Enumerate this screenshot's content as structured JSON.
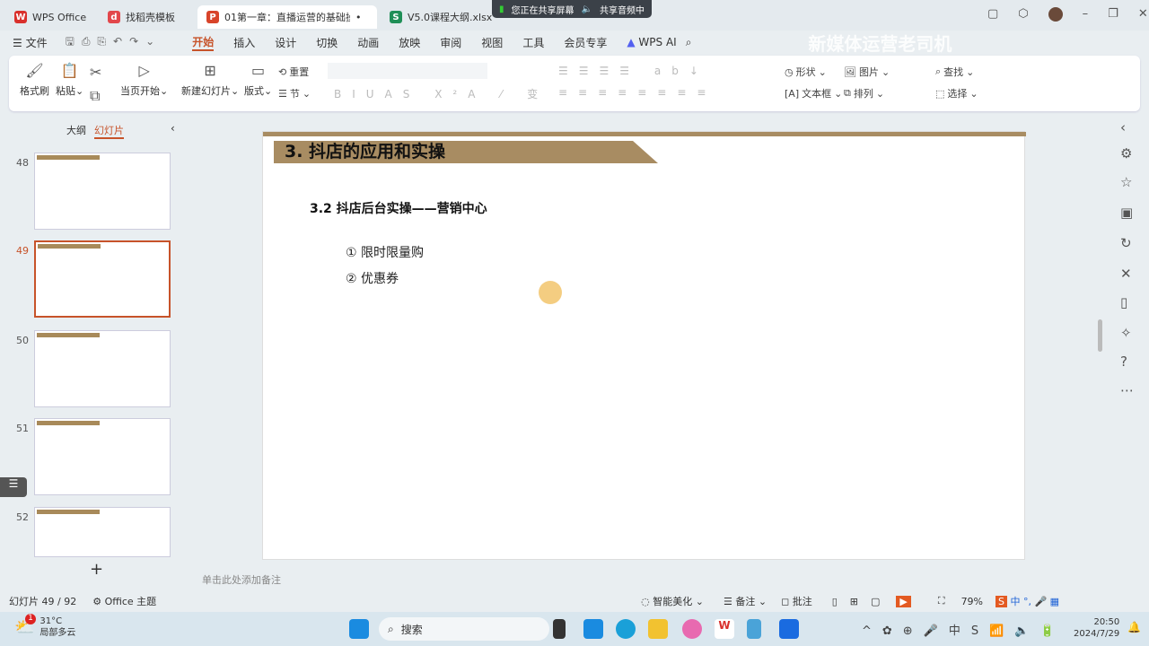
{
  "tabs": [
    {
      "label": "WPS Office",
      "icon": "wps-logo",
      "color": "#d9302c"
    },
    {
      "label": "找稻壳模板",
      "icon": "docer-icon",
      "color": "#e2474b"
    },
    {
      "label": "01第一章：直播运营的基础操",
      "icon": "presentation-icon",
      "color": "#d8442a"
    },
    {
      "label": "V5.0课程大纲.xlsx",
      "icon": "spreadsheet-icon",
      "color": "#1f8f57"
    }
  ],
  "share": {
    "screen": "您正在共享屏幕",
    "audio": "共享音频中"
  },
  "menu": {
    "file": "文件",
    "items": [
      "开始",
      "插入",
      "设计",
      "切换",
      "动画",
      "放映",
      "审阅",
      "视图",
      "工具",
      "会员专享"
    ],
    "ai": "WPS AI"
  },
  "watermark": "新媒体运营老司机",
  "ribbon": {
    "format_painter": "格式刷",
    "paste": "粘贴",
    "from_current": "当页开始",
    "new_slide": "新建幻灯片",
    "layout": "版式",
    "reset": "重置",
    "section": "节",
    "shape": "形状",
    "picture": "图片",
    "textbox": "文本框",
    "arrange": "排列",
    "find": "查找",
    "select": "选择"
  },
  "panel": {
    "outline": "大纲",
    "slides": "幻灯片",
    "thumbs": [
      {
        "num": "48"
      },
      {
        "num": "49",
        "selected": true
      },
      {
        "num": "50"
      },
      {
        "num": "51"
      },
      {
        "num": "52"
      }
    ],
    "add": "+"
  },
  "slide": {
    "title": "3. 抖店的应用和实操",
    "subtitle": "3.2  抖店后台实操——营销中心",
    "items": [
      "①  限时限量购",
      "②  优惠券"
    ]
  },
  "notes_placeholder": "单击此处添加备注",
  "status": {
    "slide_count": "幻灯片 49 / 92",
    "theme": "Office 主题",
    "beautify": "智能美化",
    "notes": "备注",
    "comment": "批注",
    "zoom": "79%"
  },
  "taskbar": {
    "temp": "31°C",
    "weather": "局部多云",
    "badge": "1",
    "search": "搜索",
    "time": "20:50",
    "date": "2024/7/29",
    "ime": "中"
  }
}
